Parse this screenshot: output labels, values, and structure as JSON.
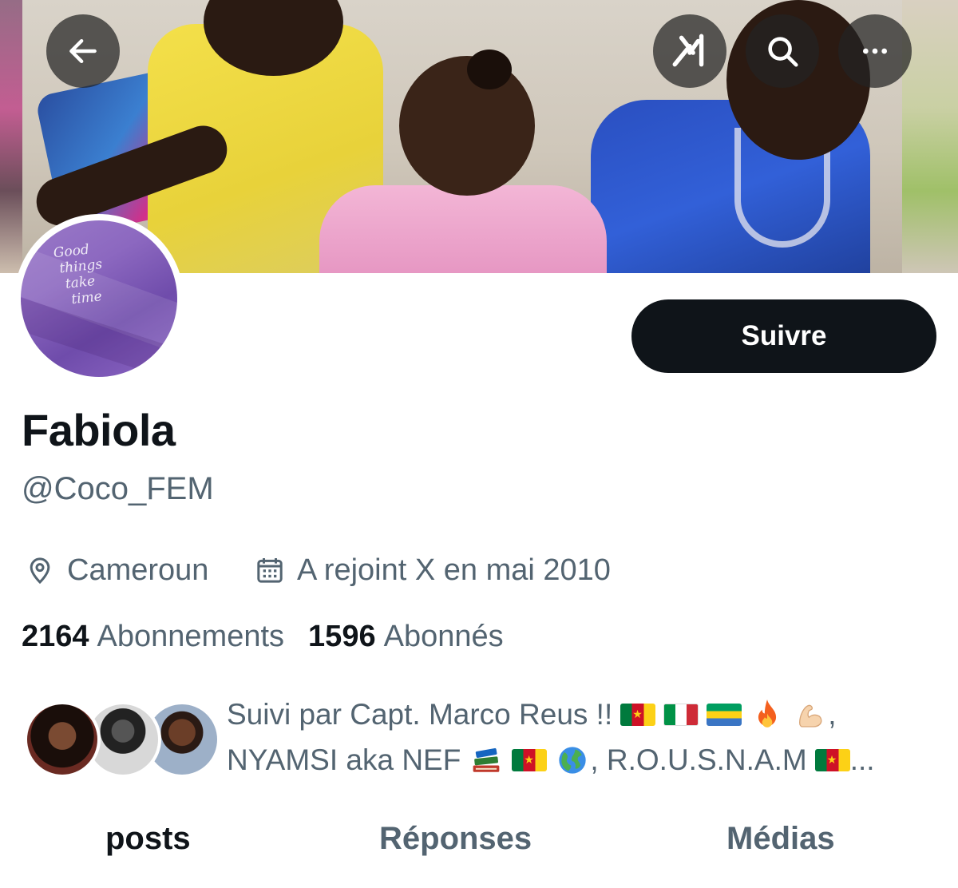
{
  "header": {
    "back_icon": "arrow-left-icon",
    "grok_icon": "grok-icon",
    "search_icon": "search-icon",
    "more_icon": "more-horizontal-icon"
  },
  "avatar": {
    "text": "Good\n things\n  take\n   time"
  },
  "profile": {
    "follow_label": "Suivre",
    "name": "Fabiola",
    "handle": "@Coco_FEM",
    "location": "Cameroun",
    "joined": "A rejoint X en mai 2010",
    "following_count": "2164",
    "following_label": "Abonnements",
    "followers_count": "1596",
    "followers_label": "Abonnés"
  },
  "followed_by": {
    "line1": "Suivi par Capt. Marco Reus !!",
    "line1_end": ",",
    "line2_a": "NYAMSI aka NEF",
    "line2_b": ", R.O.U.S.N.A.M",
    "line2_end": "..."
  },
  "tabs": [
    {
      "label": "posts",
      "active": true
    },
    {
      "label": "Réponses",
      "active": false
    },
    {
      "label": "Médias",
      "active": false
    }
  ],
  "colors": {
    "text_primary": "#0f1419",
    "text_secondary": "#536471",
    "button_dark": "#0f1419"
  }
}
